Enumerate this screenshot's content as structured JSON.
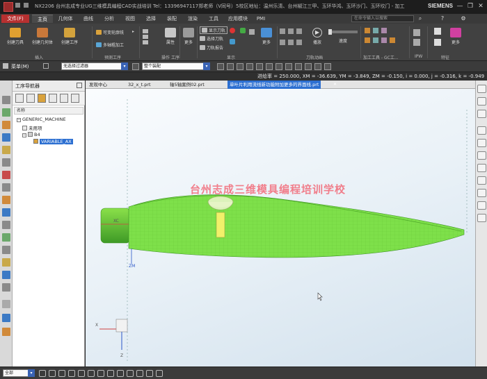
{
  "app": {
    "title": "NX2206 台州志成专业UG三维模具编程CAD实战培训 Tel：13396947117郑老师（V同号）5校区地址：温州乐清、台州椒江三甲、玉环华鸿、玉环沙门、玉环坎门 - 加工",
    "brand": "SIEMENS",
    "window_buttons": [
      "▢",
      "▢",
      "?",
      "—",
      "❐",
      "✕"
    ]
  },
  "menubar": {
    "file_label": "文件(F)",
    "tabs": [
      "主页",
      "几何体",
      "曲线",
      "分析",
      "视图",
      "选择",
      "装配",
      "渲染",
      "工具",
      "应用模块",
      "PMI"
    ],
    "active_tab": "主页",
    "search_placeholder": "在命令输入以搜索"
  },
  "ribbon": {
    "insert": {
      "label": "插入",
      "buttons": [
        "创建刀具",
        "创建几何体",
        "创建工序"
      ]
    },
    "predefined": {
      "label": "预测工序",
      "items": [
        "可变轮廓铣",
        "多轴粗加工"
      ]
    },
    "operation": {
      "label": "操作",
      "buttons": [
        "属性",
        "更多"
      ]
    },
    "process": {
      "label": "工序",
      "buttons": [
        "更多"
      ]
    },
    "display": {
      "label": "显示",
      "items": [
        "显示刀轨",
        "选择刀轨",
        "刀轨报告"
      ],
      "more": "更多"
    },
    "toolpath_anim": {
      "label": "刀轨动画",
      "buttons": [
        "播放",
        "速度"
      ]
    },
    "machining_tools": {
      "label": "加工工具 - GC工..."
    },
    "ipw": {
      "label": "IPW"
    },
    "feature": {
      "label": "特征",
      "buttons": [
        "更多"
      ]
    }
  },
  "selbar": {
    "menu_label": "菜单(M)",
    "filter": "无选择过滤器",
    "scope": "整个装配"
  },
  "coords": {
    "text": "进给率 = 250.000, XM = -36.639, YM = -3.849, ZM = -0.150, i = 0.000, j = -0.316, k = -0.949"
  },
  "navigator": {
    "title": "工序导航器",
    "column": "名称",
    "tree": [
      {
        "label": "GENERIC_MACHINE"
      },
      {
        "label": "未用项"
      },
      {
        "label": "B4"
      },
      {
        "label": "VARIABLE_AX"
      }
    ]
  },
  "doctabs": {
    "tabs": [
      "发现中心",
      "32_x_t.prt",
      "轴5轴案例02.prt",
      "单叶片利用流线新功能附加更多的界面线.prt"
    ],
    "active": "单叶片利用流线新功能附加更多的界面线.prt"
  },
  "viewport": {
    "watermark": "台州志成三维模具编程培训学校",
    "axis_labels": {
      "xc": "XC",
      "zm": "ZM",
      "x": "X",
      "z": "Z"
    }
  },
  "bottombar": {
    "scope": "全部"
  },
  "colors": {
    "accent_red": "#b73030",
    "selection_blue": "#2c6fd1",
    "blade_green": "#7ee04a",
    "watermark_pink": "#f26a78"
  }
}
